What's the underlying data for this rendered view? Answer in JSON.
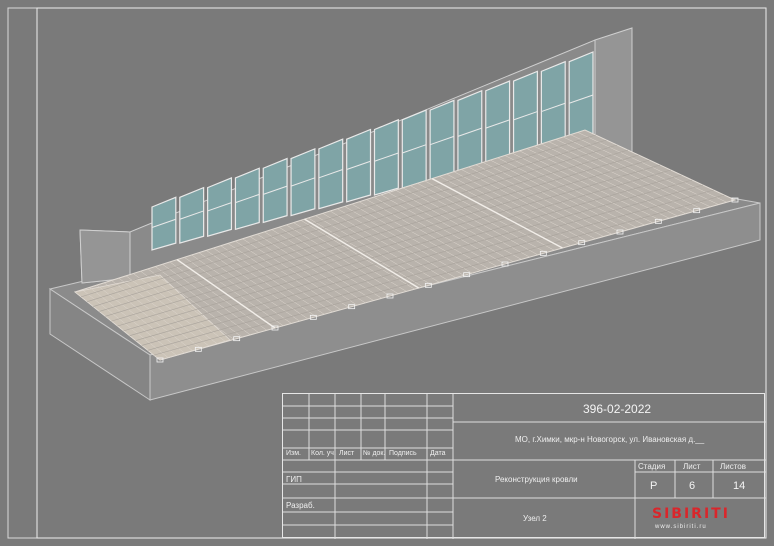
{
  "title_block": {
    "project_code": "396-02-2022",
    "address": "МО, г.Химки, мкр-н Новогорск, ул. Ивановская д.__",
    "project_name": "Реконструкция кровли",
    "node_name": "Узел 2",
    "columns": [
      "Изм.",
      "Кол. уч.",
      "Лист",
      "№ док.",
      "Подпись",
      "Дата"
    ],
    "role_gip": "ГИП",
    "role_developer": "Разраб.",
    "stage_label": "Стадия",
    "sheet_label": "Лист",
    "sheets_label": "Листов",
    "stage_value": "Р",
    "sheet_value": "6",
    "sheets_value": "14"
  },
  "logo": {
    "text": "SIBIRITI",
    "website": "www.sibiriti.ru",
    "color": "#d9262b"
  },
  "colors": {
    "background": "#7a7a7a",
    "frame": "#e6e6e6",
    "glass": "#7fa4a6",
    "grating": "#c9c3bc"
  }
}
